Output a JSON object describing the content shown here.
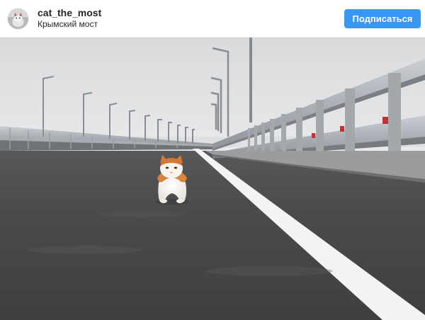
{
  "post": {
    "username": "cat_the_most",
    "location": "Крымский мост",
    "follow_label": "Подписаться",
    "avatar": {
      "icon": "cat-avatar-icon"
    }
  },
  "colors": {
    "accent": "#3897f0",
    "text": "#262626"
  }
}
